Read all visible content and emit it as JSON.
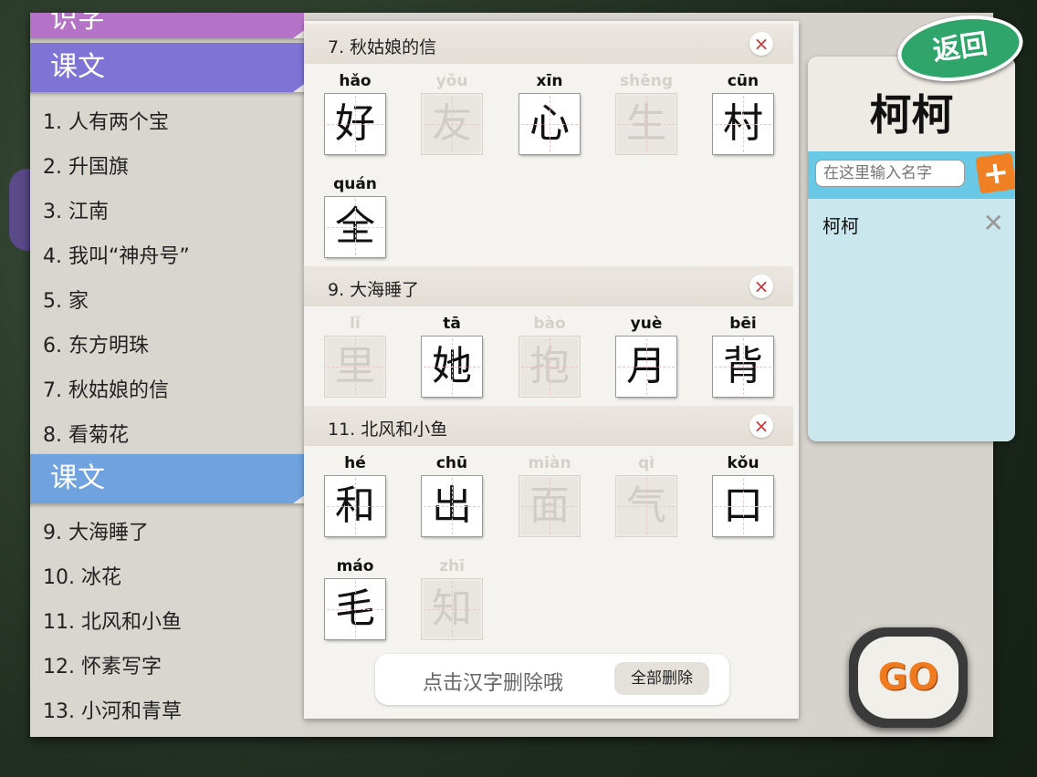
{
  "left_list": {
    "top_tab_label": "识字",
    "tab1_label": "课文",
    "items1": [
      "1. 人有两个宝",
      "2. 升国旗",
      "3. 江南",
      "4. 我叫“神舟号”",
      "5. 家",
      "6. 东方明珠",
      "7. 秋姑娘的信",
      "8. 看菊花"
    ],
    "tab2_label": "课文",
    "items2": [
      "9. 大海睡了",
      "10. 冰花",
      "11. 北风和小鱼",
      "12. 怀素写字",
      "13. 小河和青草"
    ]
  },
  "sections": [
    {
      "title": "7. 秋姑娘的信",
      "chars": [
        {
          "py": "hǎo",
          "ch": "好",
          "active": true
        },
        {
          "py": "yǒu",
          "ch": "友",
          "active": false
        },
        {
          "py": "xīn",
          "ch": "心",
          "active": true
        },
        {
          "py": "shēng",
          "ch": "生",
          "active": false
        },
        {
          "py": "cūn",
          "ch": "村",
          "active": true
        },
        {
          "py": "quán",
          "ch": "全",
          "active": true
        }
      ]
    },
    {
      "title": "9. 大海睡了",
      "chars": [
        {
          "py": "lǐ",
          "ch": "里",
          "active": false
        },
        {
          "py": "tā",
          "ch": "她",
          "active": true
        },
        {
          "py": "bào",
          "ch": "抱",
          "active": false
        },
        {
          "py": "yuè",
          "ch": "月",
          "active": true
        },
        {
          "py": "bēi",
          "ch": "背",
          "active": true
        }
      ]
    },
    {
      "title": "11. 北风和小鱼",
      "chars": [
        {
          "py": "hé",
          "ch": "和",
          "active": true
        },
        {
          "py": "chū",
          "ch": "出",
          "active": true
        },
        {
          "py": "miàn",
          "ch": "面",
          "active": false
        },
        {
          "py": "qì",
          "ch": "气",
          "active": false
        },
        {
          "py": "kǒu",
          "ch": "口",
          "active": true
        },
        {
          "py": "máo",
          "ch": "毛",
          "active": true
        },
        {
          "py": "zhī",
          "ch": "知",
          "active": false
        }
      ]
    }
  ],
  "bottom": {
    "hint": "点击汉字删除哦",
    "delete_all": "全部删除"
  },
  "right": {
    "back_label": "返回",
    "current_name": "柯柯",
    "input_placeholder": "在这里输入名字",
    "add_icon": "plus-icon",
    "names": [
      "柯柯"
    ]
  },
  "go_label": "GO",
  "close_glyph": "×",
  "colors": {
    "tab_purple": "#7f74d6",
    "tab_blue": "#6fa2de",
    "accent_orange": "#f07a1e",
    "back_green": "#2fa56b"
  }
}
